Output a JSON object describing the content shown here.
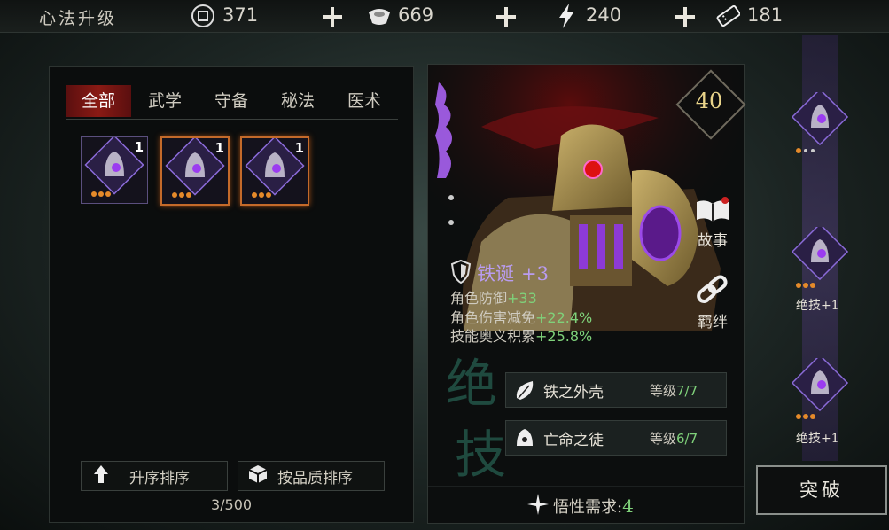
{
  "header": {
    "title": "心法升级",
    "resources": [
      {
        "icon": "coin-icon",
        "value": "371"
      },
      {
        "icon": "silver-ingot-icon",
        "value": "669"
      },
      {
        "icon": "lightning-icon",
        "value": "240"
      },
      {
        "icon": "ticket-icon",
        "value": "181"
      }
    ]
  },
  "tabs": [
    "全部",
    "武学",
    "守备",
    "秘法",
    "医术"
  ],
  "inventory": {
    "items": [
      {
        "qty": "1",
        "selected": false
      },
      {
        "qty": "1",
        "selected": true
      },
      {
        "qty": "1",
        "selected": true
      }
    ],
    "sort_ascending_label": "升序排序",
    "sort_quality_label": "按品质排序",
    "count": "3/500"
  },
  "detail": {
    "level": "40",
    "story_label": "故事",
    "bond_label": "羁绊",
    "name": "铁诞",
    "enhance": "+3",
    "stats": [
      {
        "label": "角色防御",
        "value": "+33"
      },
      {
        "label": "角色伤害减免",
        "value": "+22.4%"
      },
      {
        "label": "技能奥义积累",
        "value": "+25.8%"
      }
    ],
    "ultimate_label": "绝技",
    "skills": [
      {
        "name": "铁之外壳",
        "level_label": "等级",
        "level": "7/7"
      },
      {
        "name": "亡命之徒",
        "level_label": "等级",
        "level": "6/7"
      }
    ],
    "insight_label": "悟性需求:",
    "insight_value": "4"
  },
  "right_column": {
    "slot_labels": [
      "绝技+1",
      "绝技+1"
    ],
    "breakthrough_label": "突破"
  },
  "colors": {
    "accent_red": "#8a1a14",
    "rarity_purple": "#8a4ad8",
    "selected_border": "#c46a2a",
    "bonus_green": "#7fd17a"
  }
}
